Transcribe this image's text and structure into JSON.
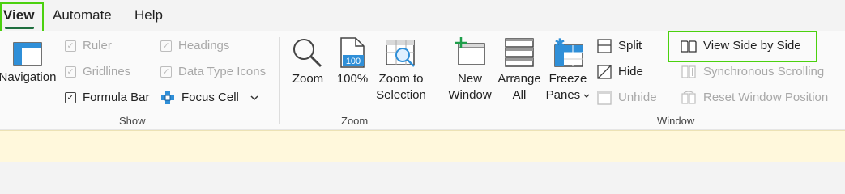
{
  "tabs": {
    "view": "View",
    "automate": "Automate",
    "help": "Help"
  },
  "show": {
    "navigation": "Navigation",
    "ruler": "Ruler",
    "gridlines": "Gridlines",
    "formula_bar": "Formula Bar",
    "headings": "Headings",
    "data_type_icons": "Data Type Icons",
    "focus_cell": "Focus Cell",
    "group_label": "Show"
  },
  "zoom": {
    "zoom": "Zoom",
    "hundred_line": "100%",
    "hundred_icon_text": "100",
    "zoom_to_1": "Zoom to",
    "zoom_to_2": "Selection",
    "group_label": "Zoom"
  },
  "window": {
    "new_1": "New",
    "new_2": "Window",
    "arrange_1": "Arrange",
    "arrange_2": "All",
    "freeze_1": "Freeze",
    "freeze_2": "Panes",
    "split": "Split",
    "hide": "Hide",
    "unhide": "Unhide",
    "side_by_side": "View Side by Side",
    "sync_scroll": "Synchronous Scrolling",
    "reset_position": "Reset Window Position",
    "group_label": "Window"
  },
  "colors": {
    "highlight": "#4bd10f",
    "accent": "#1e6e3e",
    "message_bar": "#fff8dc"
  }
}
